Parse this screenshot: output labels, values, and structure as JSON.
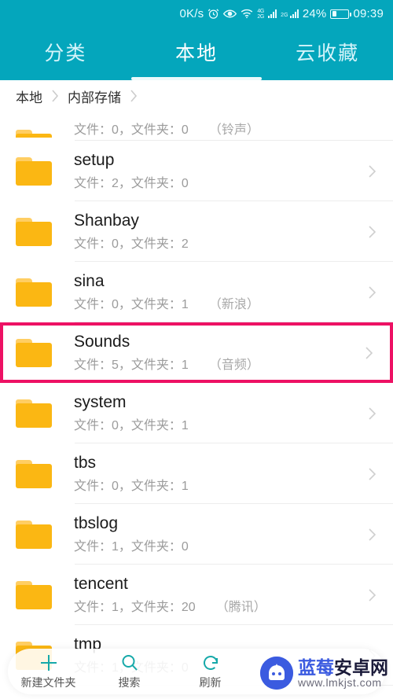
{
  "status_bar": {
    "network_speed": "0K/s",
    "icons": [
      "alarm-clock-icon",
      "eye-icon",
      "wifi-icon",
      "signal-4g-icon",
      "signal-2g-icon"
    ],
    "signal_4g_label": "4G",
    "signal_4g_sub": "2G",
    "signal_2g_label": "2G",
    "battery_percent": "24%",
    "battery_level": 24,
    "time": "09:39",
    "background_color": "#04A6BC"
  },
  "tabs": {
    "items": [
      {
        "label": "分类",
        "active": false
      },
      {
        "label": "本地",
        "active": true
      },
      {
        "label": "云收藏",
        "active": false
      }
    ],
    "active_index": 1,
    "accent_color": "#04A6BC"
  },
  "breadcrumb": {
    "items": [
      "本地",
      "内部存储"
    ]
  },
  "list": {
    "partial_top_row": {
      "meta": "文件：0，文件夹：0",
      "alias": "（铃声）"
    },
    "rows": [
      {
        "name": "setup",
        "meta": "文件：2，文件夹：0",
        "alias": "",
        "highlighted": false
      },
      {
        "name": "Shanbay",
        "meta": "文件：0，文件夹：2",
        "alias": "",
        "highlighted": false
      },
      {
        "name": "sina",
        "meta": "文件：0，文件夹：1",
        "alias": "（新浪）",
        "highlighted": false
      },
      {
        "name": "Sounds",
        "meta": "文件：5，文件夹：1",
        "alias": "（音频）",
        "highlighted": true
      },
      {
        "name": "system",
        "meta": "文件：0，文件夹：1",
        "alias": "",
        "highlighted": false
      },
      {
        "name": "tbs",
        "meta": "文件：0，文件夹：1",
        "alias": "",
        "highlighted": false
      },
      {
        "name": "tbslog",
        "meta": "文件：1，文件夹：0",
        "alias": "",
        "highlighted": false
      },
      {
        "name": "tencent",
        "meta": "文件：1，文件夹：20",
        "alias": "（腾讯）",
        "highlighted": false
      },
      {
        "name": "tmp",
        "meta": "文件：1，文件夹：0",
        "alias": "",
        "highlighted": false
      }
    ],
    "highlight_color": "#ED1164",
    "folder_icon_color": "#FBB713"
  },
  "toolbar": {
    "items": [
      {
        "label": "新建文件夹",
        "icon": "plus-icon"
      },
      {
        "label": "搜索",
        "icon": "search-icon"
      },
      {
        "label": "刷新",
        "icon": "refresh-icon"
      }
    ],
    "icon_color": "#16A9A9"
  },
  "watermark": {
    "site_name_1": "蓝莓",
    "site_name_2": "安卓网",
    "url": "www.lmkjst.com",
    "color": "#3B5BE0"
  }
}
